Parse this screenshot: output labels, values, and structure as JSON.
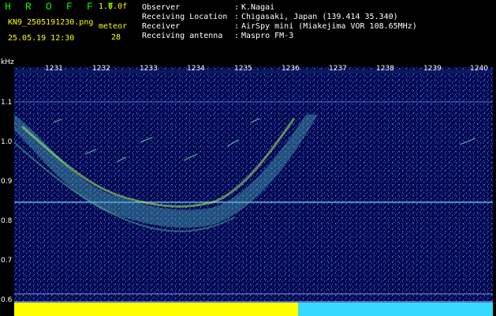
{
  "header": {
    "app_name": "H R O F F T",
    "version": "1.0.0f",
    "filename": "KN9_2505191230.png",
    "date_time": "25.05.19 12:30",
    "meteor_label": "meteor",
    "meteor_count": "28",
    "info": [
      {
        "label": "Observer",
        "value": "K.Nagai"
      },
      {
        "label": "Receiving Location",
        "value": "Chigasaki, Japan (139.414 35.340)"
      },
      {
        "label": "Receiver",
        "value": "AirSpy mini (Miakejima VOR 108.65MHz)"
      },
      {
        "label": "Receiving antenna",
        "value": "Maspro FM-3"
      }
    ]
  },
  "spectrogram": {
    "y_unit": "kHz",
    "y_ticks": [
      "1.1",
      "1.0",
      "0.9",
      "0.8",
      "0.7",
      "0.6"
    ],
    "x_ticks": [
      "1231",
      "1232",
      "1233",
      "1234",
      "1235",
      "1236",
      "1237",
      "1238",
      "1239",
      "1240"
    ],
    "colors": {
      "background": "#000000",
      "noise_low": "#03033a",
      "noise_mid": "#1a3fa8",
      "signal": "#5cc7a0",
      "highlight": "#b7f25a",
      "baseline_yellow": "#fefe00",
      "baseline_cyan": "#36d9ff"
    }
  }
}
